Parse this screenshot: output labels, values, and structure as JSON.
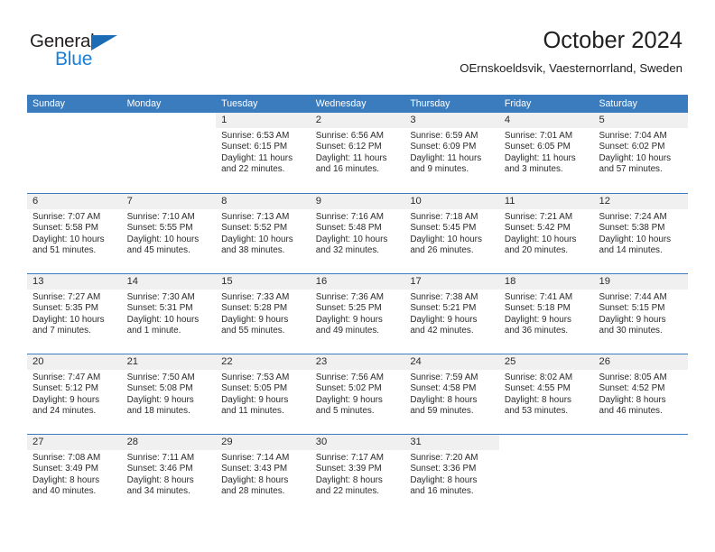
{
  "brand": {
    "name_top": "General",
    "name_bottom": "Blue",
    "accent_color": "#1b7fd4",
    "triangle_color": "#1b6cb5"
  },
  "header": {
    "title": "October 2024",
    "subtitle": "OErnskoeldsvik, Vaesternorrland, Sweden"
  },
  "theme": {
    "header_row_bg": "#3a7cbe",
    "header_row_text": "#ffffff",
    "daynum_band_bg": "#f0f0f0",
    "body_bg": "#ffffff",
    "text_color": "#2b2b2b"
  },
  "weekdays": [
    "Sunday",
    "Monday",
    "Tuesday",
    "Wednesday",
    "Thursday",
    "Friday",
    "Saturday"
  ],
  "weeks": [
    [
      {
        "day": "",
        "sunrise": "",
        "sunset": "",
        "daylight_line1": "",
        "daylight_line2": ""
      },
      {
        "day": "",
        "sunrise": "",
        "sunset": "",
        "daylight_line1": "",
        "daylight_line2": ""
      },
      {
        "day": "1",
        "sunrise": "Sunrise: 6:53 AM",
        "sunset": "Sunset: 6:15 PM",
        "daylight_line1": "Daylight: 11 hours",
        "daylight_line2": "and 22 minutes."
      },
      {
        "day": "2",
        "sunrise": "Sunrise: 6:56 AM",
        "sunset": "Sunset: 6:12 PM",
        "daylight_line1": "Daylight: 11 hours",
        "daylight_line2": "and 16 minutes."
      },
      {
        "day": "3",
        "sunrise": "Sunrise: 6:59 AM",
        "sunset": "Sunset: 6:09 PM",
        "daylight_line1": "Daylight: 11 hours",
        "daylight_line2": "and 9 minutes."
      },
      {
        "day": "4",
        "sunrise": "Sunrise: 7:01 AM",
        "sunset": "Sunset: 6:05 PM",
        "daylight_line1": "Daylight: 11 hours",
        "daylight_line2": "and 3 minutes."
      },
      {
        "day": "5",
        "sunrise": "Sunrise: 7:04 AM",
        "sunset": "Sunset: 6:02 PM",
        "daylight_line1": "Daylight: 10 hours",
        "daylight_line2": "and 57 minutes."
      }
    ],
    [
      {
        "day": "6",
        "sunrise": "Sunrise: 7:07 AM",
        "sunset": "Sunset: 5:58 PM",
        "daylight_line1": "Daylight: 10 hours",
        "daylight_line2": "and 51 minutes."
      },
      {
        "day": "7",
        "sunrise": "Sunrise: 7:10 AM",
        "sunset": "Sunset: 5:55 PM",
        "daylight_line1": "Daylight: 10 hours",
        "daylight_line2": "and 45 minutes."
      },
      {
        "day": "8",
        "sunrise": "Sunrise: 7:13 AM",
        "sunset": "Sunset: 5:52 PM",
        "daylight_line1": "Daylight: 10 hours",
        "daylight_line2": "and 38 minutes."
      },
      {
        "day": "9",
        "sunrise": "Sunrise: 7:16 AM",
        "sunset": "Sunset: 5:48 PM",
        "daylight_line1": "Daylight: 10 hours",
        "daylight_line2": "and 32 minutes."
      },
      {
        "day": "10",
        "sunrise": "Sunrise: 7:18 AM",
        "sunset": "Sunset: 5:45 PM",
        "daylight_line1": "Daylight: 10 hours",
        "daylight_line2": "and 26 minutes."
      },
      {
        "day": "11",
        "sunrise": "Sunrise: 7:21 AM",
        "sunset": "Sunset: 5:42 PM",
        "daylight_line1": "Daylight: 10 hours",
        "daylight_line2": "and 20 minutes."
      },
      {
        "day": "12",
        "sunrise": "Sunrise: 7:24 AM",
        "sunset": "Sunset: 5:38 PM",
        "daylight_line1": "Daylight: 10 hours",
        "daylight_line2": "and 14 minutes."
      }
    ],
    [
      {
        "day": "13",
        "sunrise": "Sunrise: 7:27 AM",
        "sunset": "Sunset: 5:35 PM",
        "daylight_line1": "Daylight: 10 hours",
        "daylight_line2": "and 7 minutes."
      },
      {
        "day": "14",
        "sunrise": "Sunrise: 7:30 AM",
        "sunset": "Sunset: 5:31 PM",
        "daylight_line1": "Daylight: 10 hours",
        "daylight_line2": "and 1 minute."
      },
      {
        "day": "15",
        "sunrise": "Sunrise: 7:33 AM",
        "sunset": "Sunset: 5:28 PM",
        "daylight_line1": "Daylight: 9 hours",
        "daylight_line2": "and 55 minutes."
      },
      {
        "day": "16",
        "sunrise": "Sunrise: 7:36 AM",
        "sunset": "Sunset: 5:25 PM",
        "daylight_line1": "Daylight: 9 hours",
        "daylight_line2": "and 49 minutes."
      },
      {
        "day": "17",
        "sunrise": "Sunrise: 7:38 AM",
        "sunset": "Sunset: 5:21 PM",
        "daylight_line1": "Daylight: 9 hours",
        "daylight_line2": "and 42 minutes."
      },
      {
        "day": "18",
        "sunrise": "Sunrise: 7:41 AM",
        "sunset": "Sunset: 5:18 PM",
        "daylight_line1": "Daylight: 9 hours",
        "daylight_line2": "and 36 minutes."
      },
      {
        "day": "19",
        "sunrise": "Sunrise: 7:44 AM",
        "sunset": "Sunset: 5:15 PM",
        "daylight_line1": "Daylight: 9 hours",
        "daylight_line2": "and 30 minutes."
      }
    ],
    [
      {
        "day": "20",
        "sunrise": "Sunrise: 7:47 AM",
        "sunset": "Sunset: 5:12 PM",
        "daylight_line1": "Daylight: 9 hours",
        "daylight_line2": "and 24 minutes."
      },
      {
        "day": "21",
        "sunrise": "Sunrise: 7:50 AM",
        "sunset": "Sunset: 5:08 PM",
        "daylight_line1": "Daylight: 9 hours",
        "daylight_line2": "and 18 minutes."
      },
      {
        "day": "22",
        "sunrise": "Sunrise: 7:53 AM",
        "sunset": "Sunset: 5:05 PM",
        "daylight_line1": "Daylight: 9 hours",
        "daylight_line2": "and 11 minutes."
      },
      {
        "day": "23",
        "sunrise": "Sunrise: 7:56 AM",
        "sunset": "Sunset: 5:02 PM",
        "daylight_line1": "Daylight: 9 hours",
        "daylight_line2": "and 5 minutes."
      },
      {
        "day": "24",
        "sunrise": "Sunrise: 7:59 AM",
        "sunset": "Sunset: 4:58 PM",
        "daylight_line1": "Daylight: 8 hours",
        "daylight_line2": "and 59 minutes."
      },
      {
        "day": "25",
        "sunrise": "Sunrise: 8:02 AM",
        "sunset": "Sunset: 4:55 PM",
        "daylight_line1": "Daylight: 8 hours",
        "daylight_line2": "and 53 minutes."
      },
      {
        "day": "26",
        "sunrise": "Sunrise: 8:05 AM",
        "sunset": "Sunset: 4:52 PM",
        "daylight_line1": "Daylight: 8 hours",
        "daylight_line2": "and 46 minutes."
      }
    ],
    [
      {
        "day": "27",
        "sunrise": "Sunrise: 7:08 AM",
        "sunset": "Sunset: 3:49 PM",
        "daylight_line1": "Daylight: 8 hours",
        "daylight_line2": "and 40 minutes."
      },
      {
        "day": "28",
        "sunrise": "Sunrise: 7:11 AM",
        "sunset": "Sunset: 3:46 PM",
        "daylight_line1": "Daylight: 8 hours",
        "daylight_line2": "and 34 minutes."
      },
      {
        "day": "29",
        "sunrise": "Sunrise: 7:14 AM",
        "sunset": "Sunset: 3:43 PM",
        "daylight_line1": "Daylight: 8 hours",
        "daylight_line2": "and 28 minutes."
      },
      {
        "day": "30",
        "sunrise": "Sunrise: 7:17 AM",
        "sunset": "Sunset: 3:39 PM",
        "daylight_line1": "Daylight: 8 hours",
        "daylight_line2": "and 22 minutes."
      },
      {
        "day": "31",
        "sunrise": "Sunrise: 7:20 AM",
        "sunset": "Sunset: 3:36 PM",
        "daylight_line1": "Daylight: 8 hours",
        "daylight_line2": "and 16 minutes."
      },
      {
        "day": "",
        "sunrise": "",
        "sunset": "",
        "daylight_line1": "",
        "daylight_line2": ""
      },
      {
        "day": "",
        "sunrise": "",
        "sunset": "",
        "daylight_line1": "",
        "daylight_line2": ""
      }
    ]
  ]
}
